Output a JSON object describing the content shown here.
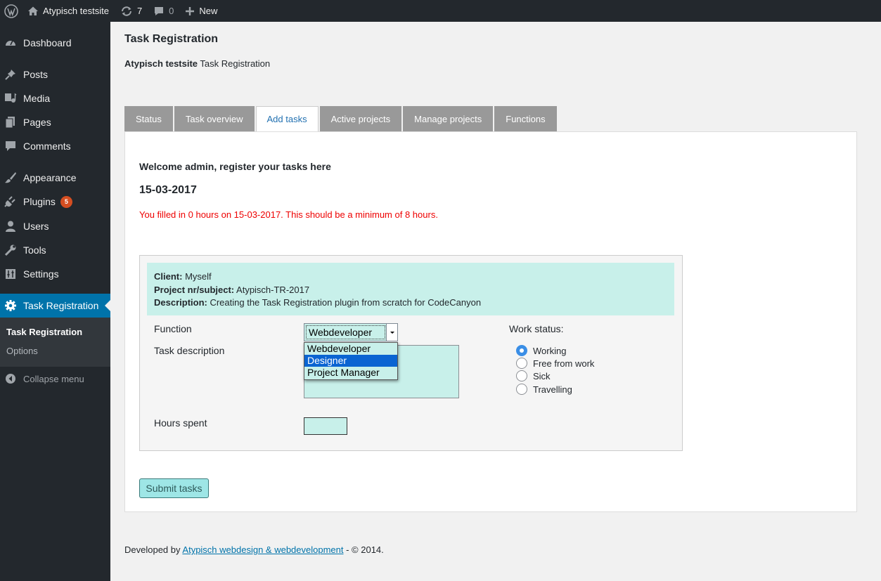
{
  "admin_bar": {
    "site_name": "Atypisch testsite",
    "updates_count": "7",
    "comments_count": "0",
    "new_label": "New"
  },
  "sidebar": {
    "items": [
      {
        "label": "Dashboard",
        "icon": "dashboard-icon"
      },
      {
        "label": "Posts",
        "icon": "pin-icon"
      },
      {
        "label": "Media",
        "icon": "media-icon"
      },
      {
        "label": "Pages",
        "icon": "pages-icon"
      },
      {
        "label": "Comments",
        "icon": "comment-icon"
      },
      {
        "label": "Appearance",
        "icon": "brush-icon"
      },
      {
        "label": "Plugins",
        "icon": "plugin-icon",
        "badge": "5"
      },
      {
        "label": "Users",
        "icon": "user-icon"
      },
      {
        "label": "Tools",
        "icon": "wrench-icon"
      },
      {
        "label": "Settings",
        "icon": "sliders-icon"
      },
      {
        "label": "Task Registration",
        "icon": "gear-icon",
        "active": true
      }
    ],
    "submenu": [
      "Task Registration",
      "Options"
    ],
    "collapse_label": "Collapse menu"
  },
  "page": {
    "title": "Task Registration",
    "subtitle_bold": "Atypisch testsite",
    "subtitle_rest": " Task Registration"
  },
  "tabs": [
    "Status",
    "Task overview",
    "Add tasks",
    "Active projects",
    "Manage projects",
    "Functions"
  ],
  "active_tab": "Add tasks",
  "panel": {
    "welcome": "Welcome admin, register your tasks here",
    "date": "15-03-2017",
    "warning": "You filled in 0 hours on 15-03-2017. This should be a minimum of 8 hours."
  },
  "project": {
    "client_label": "Client:",
    "client_value": " Myself",
    "project_label": "Project nr/subject:",
    "project_value": " Atypisch-TR-2017",
    "description_label": "Description:",
    "description_value": " Creating the Task Registration plugin from scratch for CodeCanyon"
  },
  "form": {
    "function_label": "Function",
    "task_description_label": "Task description",
    "hours_label": "Hours spent",
    "function_selected": "Webdeveloper",
    "function_options": [
      "Webdeveloper",
      "Designer",
      "Project Manager"
    ],
    "function_highlighted": "Designer",
    "work_status_label": "Work status:",
    "work_status_options": [
      "Working",
      "Free from work",
      "Sick",
      "Travelling"
    ],
    "work_status_selected": "Working",
    "task_description_value": "",
    "hours_value": ""
  },
  "submit_label": "Submit tasks",
  "footer": {
    "prefix": "Developed by ",
    "link_text": "Atypisch webdesign & webdevelopment",
    "suffix": " - © 2014."
  },
  "colors": {
    "admin_dark": "#23282d",
    "active_menu": "#0073aa",
    "input_bg": "#c8f0ea",
    "warning_red": "#e00",
    "tab_gray": "#999",
    "plugin_badge": "#d54e21"
  }
}
